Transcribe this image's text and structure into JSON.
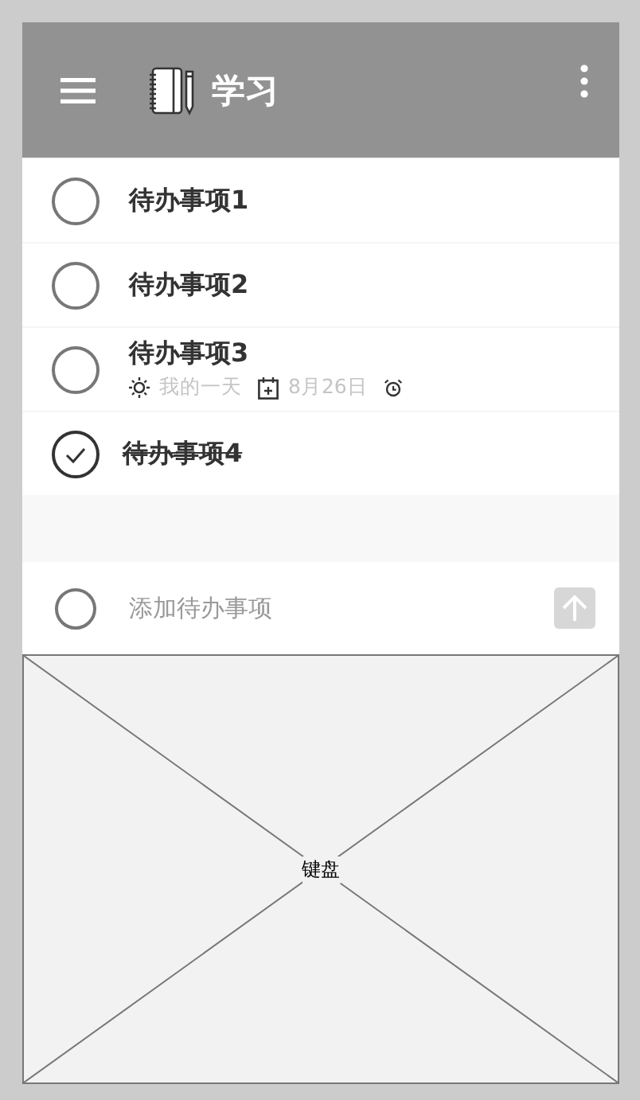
{
  "header": {
    "title": "学习"
  },
  "todos": [
    {
      "title": "待办事项1",
      "checked": false
    },
    {
      "title": "待办事项2",
      "checked": false
    },
    {
      "title": "待办事项3",
      "checked": false,
      "details": [
        {
          "kind": "my_day",
          "text": "我的一天"
        },
        {
          "kind": "due_date",
          "text": "8月26日"
        },
        {
          "kind": "reminder"
        }
      ]
    },
    {
      "title": "待办事项4",
      "checked": true
    }
  ],
  "add_task": {
    "placeholder": "添加待办事项"
  },
  "keyboard": {
    "label": "键盘"
  }
}
